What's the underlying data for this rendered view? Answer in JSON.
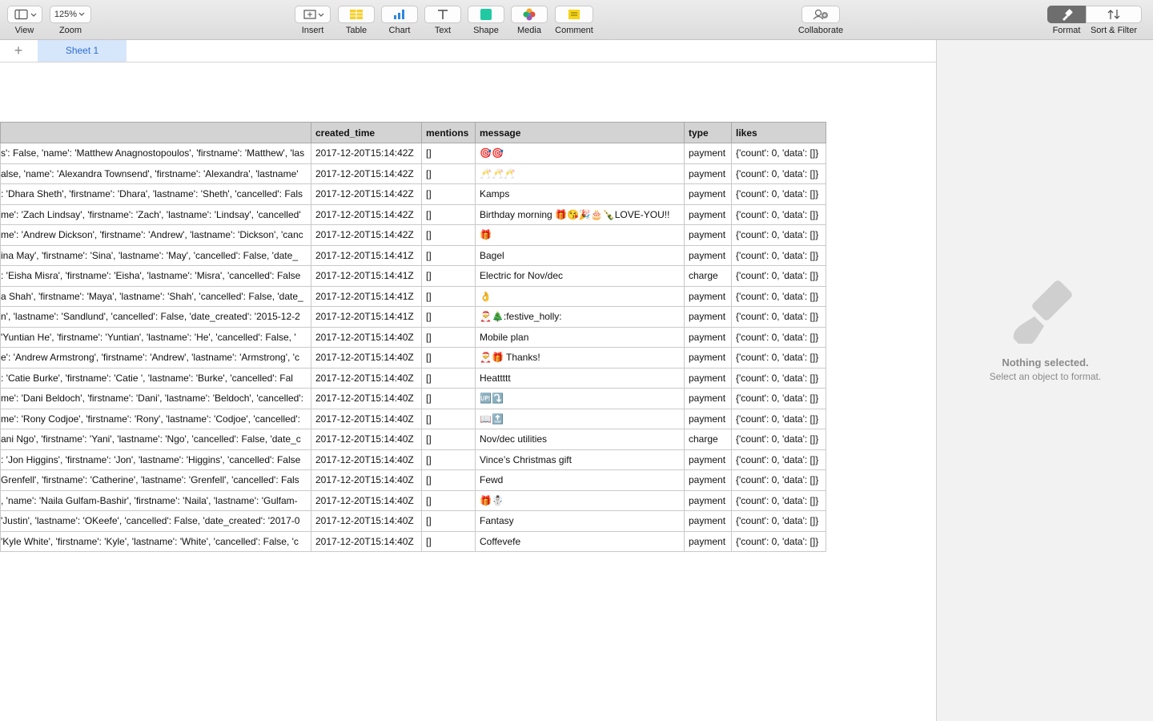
{
  "toolbar": {
    "view": "View",
    "zoom_value": "125%",
    "zoom": "Zoom",
    "insert": "Insert",
    "table": "Table",
    "chart": "Chart",
    "text": "Text",
    "shape": "Shape",
    "media": "Media",
    "comment": "Comment",
    "collaborate": "Collaborate",
    "format": "Format",
    "sort_filter": "Sort & Filter"
  },
  "tabs": {
    "sheet1": "Sheet 1"
  },
  "panel": {
    "line1": "Nothing selected.",
    "line2": "Select an object to format."
  },
  "table": {
    "headers": [
      "",
      "created_time",
      "mentions",
      "message",
      "type",
      "likes"
    ],
    "rows": [
      [
        "s': False, 'name': 'Matthew Anagnostopoulos', 'firstname': 'Matthew', 'las",
        "2017-12-20T15:14:42Z",
        "[]",
        "🎯🎯",
        "payment",
        "{'count': 0, 'data': []}"
      ],
      [
        "alse, 'name': 'Alexandra Townsend', 'firstname': 'Alexandra', 'lastname'",
        "2017-12-20T15:14:42Z",
        "[]",
        "🥂🥂🥂",
        "payment",
        "{'count': 0, 'data': []}"
      ],
      [
        ": 'Dhara Sheth', 'firstname': 'Dhara', 'lastname': 'Sheth', 'cancelled': Fals",
        "2017-12-20T15:14:42Z",
        "[]",
        "Kamps",
        "payment",
        "{'count': 0, 'data': []}"
      ],
      [
        "me': 'Zach Lindsay', 'firstname': 'Zach', 'lastname': 'Lindsay', 'cancelled'",
        "2017-12-20T15:14:42Z",
        "[]",
        "Birthday morning 🎁😘🎉🎂🍾LOVE-YOU!!",
        "payment",
        "{'count': 0, 'data': []}"
      ],
      [
        "me': 'Andrew Dickson', 'firstname': 'Andrew', 'lastname': 'Dickson', 'canc",
        "2017-12-20T15:14:42Z",
        "[]",
        "🎁",
        "payment",
        "{'count': 0, 'data': []}"
      ],
      [
        "ina May', 'firstname': 'Sina', 'lastname': 'May', 'cancelled': False, 'date_",
        "2017-12-20T15:14:41Z",
        "[]",
        "Bagel",
        "payment",
        "{'count': 0, 'data': []}"
      ],
      [
        ": 'Eisha Misra', 'firstname': 'Eisha', 'lastname': 'Misra', 'cancelled': False",
        "2017-12-20T15:14:41Z",
        "[]",
        "Electric for Nov/dec",
        "charge",
        "{'count': 0, 'data': []}"
      ],
      [
        "a Shah', 'firstname': 'Maya', 'lastname': 'Shah', 'cancelled': False, 'date_",
        "2017-12-20T15:14:41Z",
        "[]",
        "👌",
        "payment",
        "{'count': 0, 'data': []}"
      ],
      [
        "n', 'lastname': 'Sandlund', 'cancelled': False, 'date_created': '2015-12-2",
        "2017-12-20T15:14:41Z",
        "[]",
        "🎅🎄:festive_holly:",
        "payment",
        "{'count': 0, 'data': []}"
      ],
      [
        " 'Yuntian He', 'firstname': 'Yuntian', 'lastname': 'He', 'cancelled': False, '",
        "2017-12-20T15:14:40Z",
        "[]",
        "Mobile plan",
        "payment",
        "{'count': 0, 'data': []}"
      ],
      [
        "e': 'Andrew Armstrong', 'firstname': 'Andrew', 'lastname': 'Armstrong', 'c",
        "2017-12-20T15:14:40Z",
        "[]",
        "🎅🎁 Thanks!",
        "payment",
        "{'count': 0, 'data': []}"
      ],
      [
        ": 'Catie  Burke', 'firstname': 'Catie ', 'lastname': 'Burke', 'cancelled': Fal",
        "2017-12-20T15:14:40Z",
        "[]",
        "Heattttt",
        "payment",
        "{'count': 0, 'data': []}"
      ],
      [
        "me': 'Dani Beldoch', 'firstname': 'Dani', 'lastname': 'Beldoch', 'cancelled':",
        "2017-12-20T15:14:40Z",
        "[]",
        "🆙⤵️",
        "payment",
        "{'count': 0, 'data': []}"
      ],
      [
        "me': 'Rony Codjoe', 'firstname': 'Rony', 'lastname': 'Codjoe', 'cancelled':",
        "2017-12-20T15:14:40Z",
        "[]",
        "📖🔝",
        "payment",
        "{'count': 0, 'data': []}"
      ],
      [
        "ani Ngo', 'firstname': 'Yani', 'lastname': 'Ngo', 'cancelled': False, 'date_c",
        "2017-12-20T15:14:40Z",
        "[]",
        "Nov/dec utilities",
        "charge",
        "{'count': 0, 'data': []}"
      ],
      [
        ": 'Jon Higgins', 'firstname': 'Jon', 'lastname': 'Higgins', 'cancelled': False",
        "2017-12-20T15:14:40Z",
        "[]",
        "Vince’s Christmas gift",
        "payment",
        "{'count': 0, 'data': []}"
      ],
      [
        " Grenfell', 'firstname': 'Catherine', 'lastname': 'Grenfell', 'cancelled': Fals",
        "2017-12-20T15:14:40Z",
        "[]",
        "Fewd",
        "payment",
        "{'count': 0, 'data': []}"
      ],
      [
        ", 'name': 'Naila Gulfam-Bashir', 'firstname': 'Naila', 'lastname': 'Gulfam-",
        "2017-12-20T15:14:40Z",
        "[]",
        "🎁☃️",
        "payment",
        "{'count': 0, 'data': []}"
      ],
      [
        " 'Justin', 'lastname': 'OKeefe', 'cancelled': False, 'date_created': '2017-0",
        "2017-12-20T15:14:40Z",
        "[]",
        "Fantasy",
        "payment",
        "{'count': 0, 'data': []}"
      ],
      [
        "'Kyle White', 'firstname': 'Kyle', 'lastname': 'White', 'cancelled': False, 'c",
        "2017-12-20T15:14:40Z",
        "[]",
        "Coffevefe",
        "payment",
        "{'count': 0, 'data': []}"
      ]
    ]
  }
}
